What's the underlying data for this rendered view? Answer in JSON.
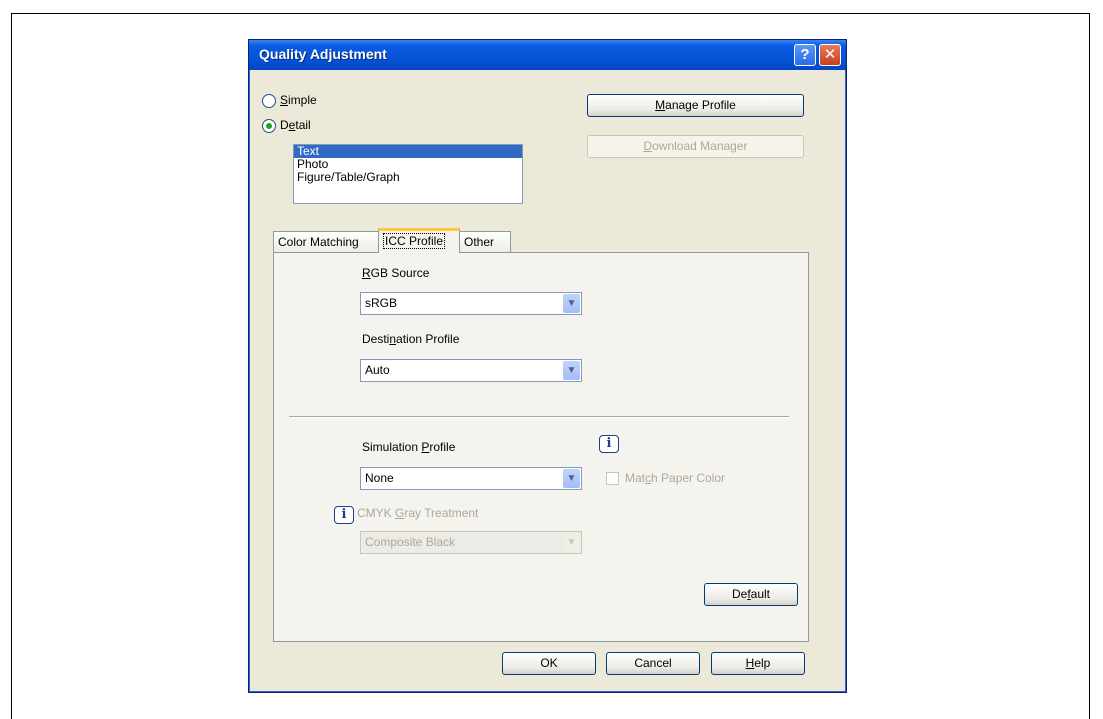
{
  "dialog": {
    "title": "Quality Adjustment",
    "help_symbol": "?",
    "close_symbol": "✕"
  },
  "mode": {
    "simple": {
      "pre": "",
      "key": "S",
      "post": "imple",
      "selected": false
    },
    "detail": {
      "pre": "D",
      "key": "e",
      "post": "tail",
      "selected": true
    }
  },
  "object_list": {
    "items": [
      "Text",
      "Photo",
      "Figure/Table/Graph"
    ],
    "selected": "Text"
  },
  "buttons": {
    "manage_profile": {
      "pre": "",
      "key": "M",
      "post": "anage Profile"
    },
    "download_manager": {
      "pre": "",
      "key": "D",
      "post": "ownload Manager",
      "enabled": false
    },
    "default": {
      "pre": "De",
      "key": "f",
      "post": "ault"
    },
    "ok": "OK",
    "cancel": "Cancel",
    "help": {
      "pre": "",
      "key": "H",
      "post": "elp"
    }
  },
  "tabs": [
    "Color Matching",
    "ICC Profile",
    "Other"
  ],
  "active_tab": "ICC Profile",
  "icc": {
    "rgb_source": {
      "label_key": "R",
      "label_post": "GB Source",
      "value": "sRGB"
    },
    "destination": {
      "label_pre": "Desti",
      "label_key": "n",
      "label_post": "ation Profile",
      "value": "Auto"
    },
    "simulation": {
      "label_pre": "Simulation ",
      "label_key": "P",
      "label_post": "rofile",
      "value": "None"
    },
    "match_paper": {
      "label_pre": "Mat",
      "label_key": "c",
      "label_post": "h Paper Color",
      "checked": false,
      "enabled": false
    },
    "cmyk_gray": {
      "label_pre": "CMYK ",
      "label_key": "G",
      "label_post": "ray Treatment",
      "value": "Composite Black",
      "enabled": false
    },
    "info_symbol": "i"
  }
}
